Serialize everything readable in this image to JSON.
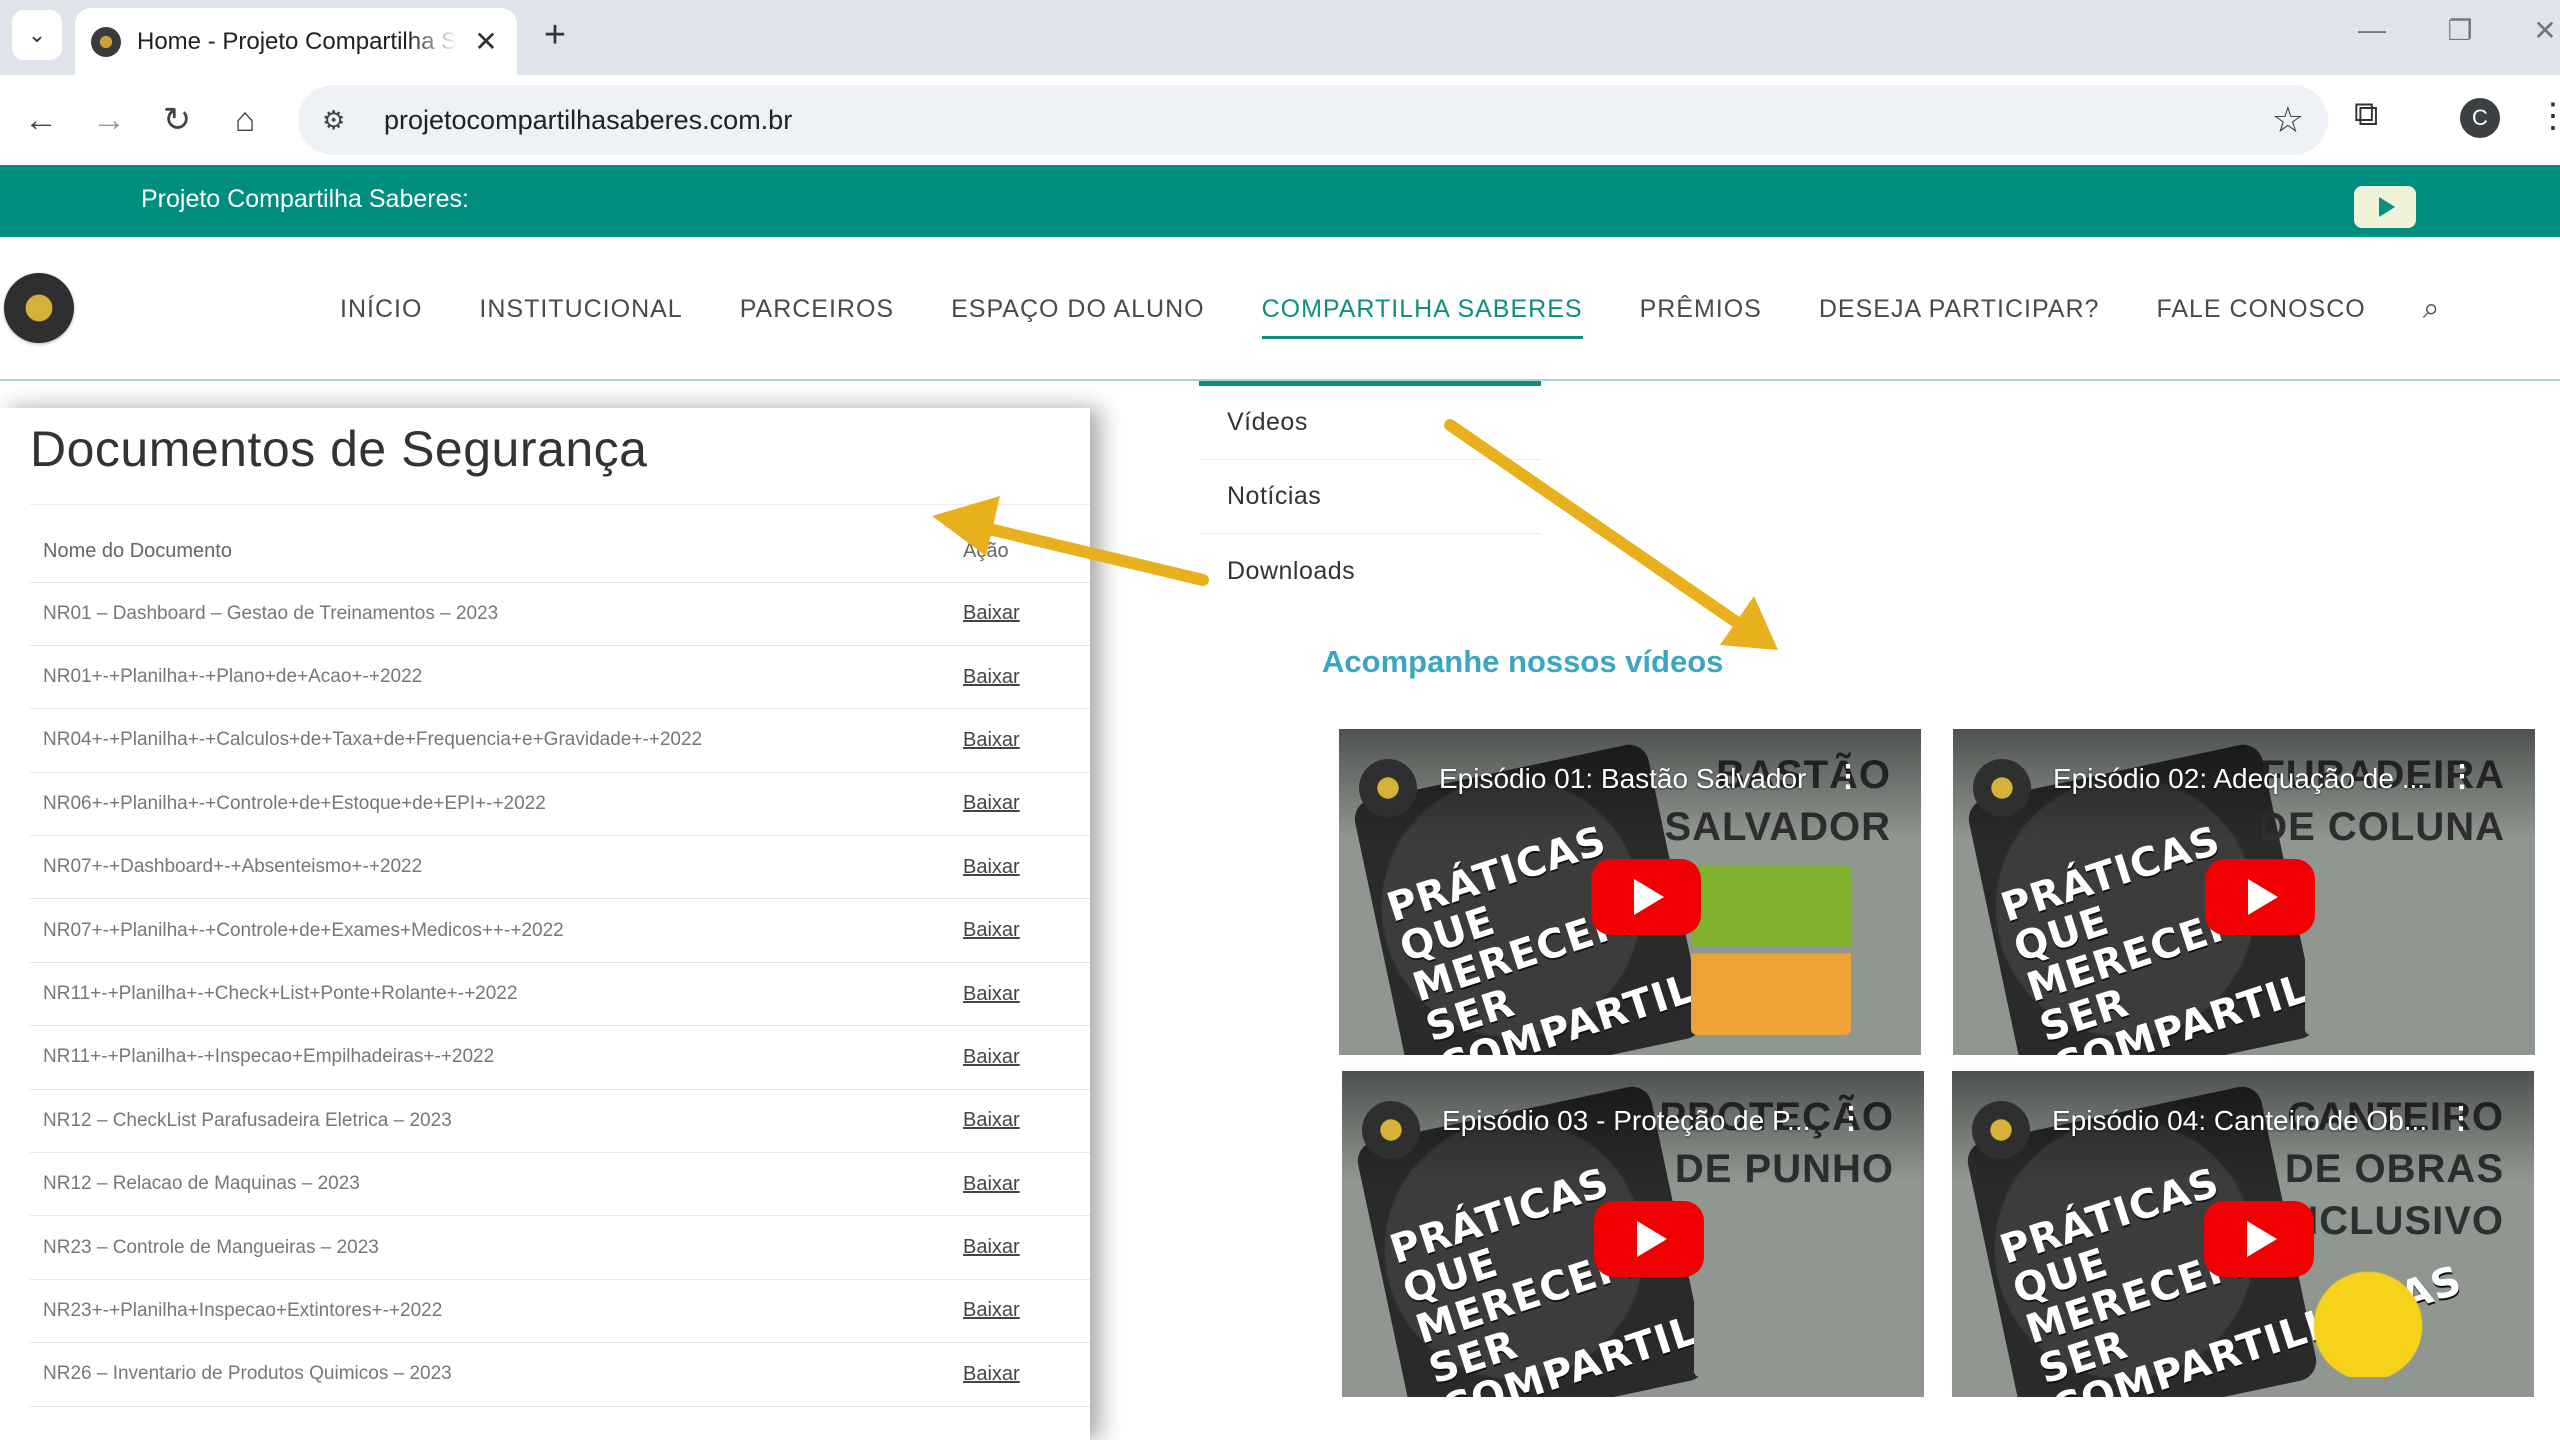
{
  "browser": {
    "tab_title": "Home - Projeto Compartilha Saberes",
    "url": "projetocompartilhasaberes.com.br",
    "profile_initial": "C"
  },
  "site": {
    "topbar_text": "Projeto Compartilha Saberes:",
    "nav": [
      {
        "label": "INÍCIO",
        "active": false
      },
      {
        "label": "INSTITUCIONAL",
        "active": false
      },
      {
        "label": "PARCEIROS",
        "active": false
      },
      {
        "label": "ESPAÇO DO ALUNO",
        "active": false
      },
      {
        "label": "COMPARTILHA SABERES",
        "active": true
      },
      {
        "label": "PRÊMIOS",
        "active": false
      },
      {
        "label": "DESEJA PARTICIPAR?",
        "active": false
      },
      {
        "label": "FALE CONOSCO",
        "active": false
      }
    ],
    "dropdown": [
      "Vídeos",
      "Notícias",
      "Downloads"
    ]
  },
  "documents": {
    "title": "Documentos de Segurança",
    "col_name": "Nome do Documento",
    "col_action": "Ação",
    "rows": [
      {
        "name": "NR01 – Dashboard – Gestao de Treinamentos – 2023",
        "action": "Baixar"
      },
      {
        "name": "NR01+-+Planilha+-+Plano+de+Acao+-+2022",
        "action": "Baixar"
      },
      {
        "name": "NR04+-+Planilha+-+Calculos+de+Taxa+de+Frequencia+e+Gravidade+-+2022",
        "action": "Baixar"
      },
      {
        "name": "NR06+-+Planilha+-+Controle+de+Estoque+de+EPI+-+2022",
        "action": "Baixar"
      },
      {
        "name": "NR07+-+Dashboard+-+Absenteismo+-+2022",
        "action": "Baixar"
      },
      {
        "name": "NR07+-+Planilha+-+Controle+de+Exames+Medicos++-+2022",
        "action": "Baixar"
      },
      {
        "name": "NR11+-+Planilha+-+Check+List+Ponte+Rolante+-+2022",
        "action": "Baixar"
      },
      {
        "name": "NR11+-+Planilha+-+Inspecao+Empilhadeiras+-+2022",
        "action": "Baixar"
      },
      {
        "name": "NR12 – CheckList Parafusadeira Eletrica – 2023",
        "action": "Baixar"
      },
      {
        "name": "NR12 – Relacao de Maquinas – 2023",
        "action": "Baixar"
      },
      {
        "name": "NR23 – Controle de Mangueiras – 2023",
        "action": "Baixar"
      },
      {
        "name": "NR23+-+Planilha+Inspecao+Extintores+-+2022",
        "action": "Baixar"
      },
      {
        "name": "NR26 – Inventario de Produtos Quimicos – 2023",
        "action": "Baixar"
      }
    ]
  },
  "videos": {
    "heading": "Acompanhe nossos vídeos",
    "book_text": "PRÁTICAS QUE MERECEM SER COMPARTILHADAS",
    "items": [
      {
        "title": "Episódio 01: Bastão Salvador",
        "overlay": "BASTÃO SALVADOR"
      },
      {
        "title": "Episódio 02: Adequação de ...",
        "overlay": "FURADEIRA DE COLUNA"
      },
      {
        "title": "Episódio 03 - Proteção de P...",
        "overlay": "PROTEÇÃO DE PUNHO"
      },
      {
        "title": "Episódio 04: Canteiro de Ob...",
        "overlay": "CANTEIRO DE OBRAS INCLUSIVO"
      }
    ]
  },
  "colors": {
    "brand_teal": "#008e81",
    "video_heading": "#3aa6c4",
    "arrow": "#e8b01c"
  }
}
